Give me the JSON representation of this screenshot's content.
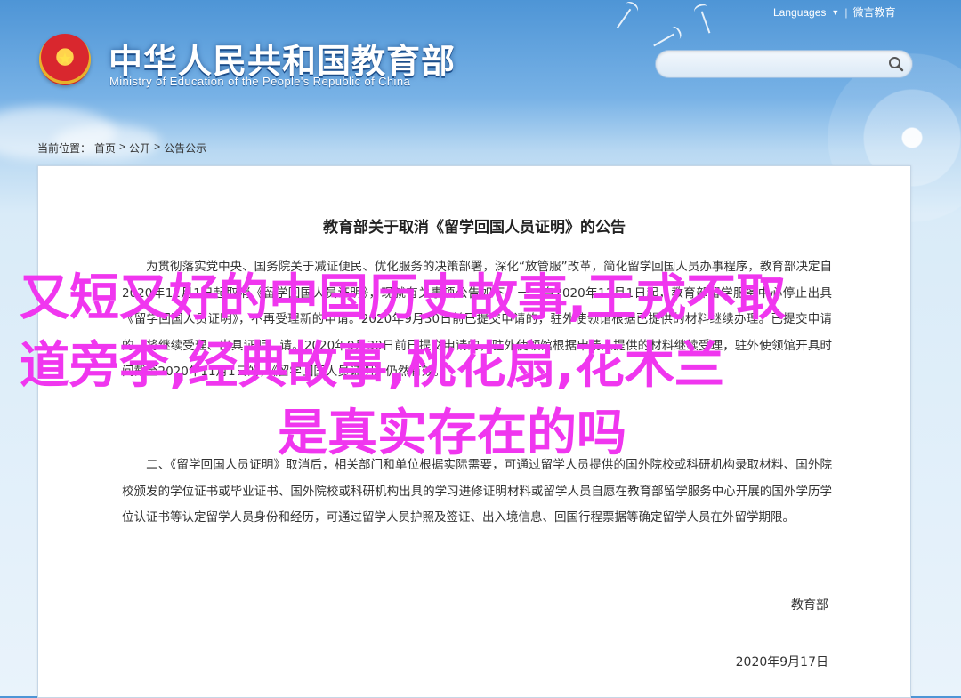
{
  "header": {
    "title": "中华人民共和国教育部",
    "subtitle": "Ministry of Education of the People's Republic of China",
    "top_links": {
      "languages": "Languages",
      "weibo": "微言教育"
    },
    "search": {
      "value": ""
    }
  },
  "breadcrumb": {
    "label": "当前位置：",
    "items": [
      "首页",
      "公开",
      "公告公示"
    ],
    "separator": ">"
  },
  "article": {
    "title": "教育部关于取消《留学回国人员证明》的公告",
    "paragraph1": "为贯彻落实党中央、国务院关于减证便民、优化服务的决策部署，深化“放管服”改革，简化留学回国人员办事程序，教育部决定自2020年11月1日起取消《留学回国人员证明》，现就有关事项公告如下：一、自2020年11月1日起，教育部留学服务中心停止出具《留学回国人员证明》，不再受理新的申请。2020年9月30日前已提交申请的，驻外使领馆根据已提供的材料继续办理。已提交申请的，将继续受理、出具证明，请。2020年9月30日前已提交申请的，驻外使领馆根据申请人提供的材料继续受理，驻外使领馆开具时间截至2020年11月1日的，《留学回国人员证明》仍然有效。",
    "paragraph2": "二、《留学回国人员证明》取消后，相关部门和单位根据实际需要，可通过留学人员提供的国外院校或科研机构录取材料、国外院校颁发的学位证书或毕业证书、国外院校或科研机构出具的学习进修证明材料或留学人员自愿在教育部留学服务中心开展的国外学历学位认证书等认定留学人员身份和经历，可通过留学人员护照及签证、出入境信息、回国行程票据等确定留学人员在外留学期限。",
    "signature": "教育部",
    "date": "2020年9月17日"
  },
  "overlay": {
    "line1": "又短又好的中国历史故事,王戎不取",
    "line2": "道旁李,经典故事,桃花扇,花木兰",
    "line3": "是真实存在的吗",
    "color": "#f036ef"
  },
  "icons": {
    "search": "search-icon",
    "emblem": "national-emblem-icon",
    "dropdown": "chevron-down-icon"
  }
}
